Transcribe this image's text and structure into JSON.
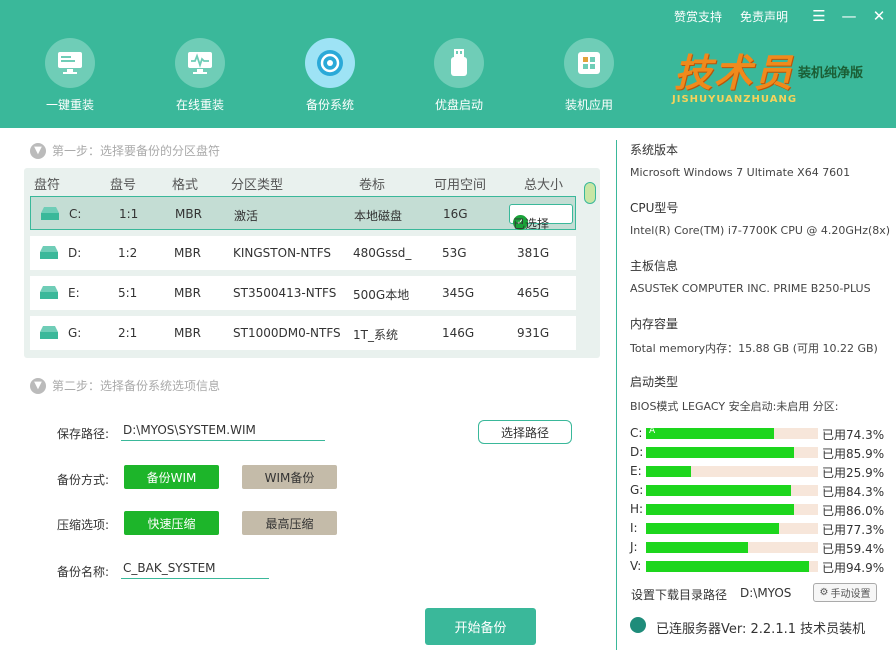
{
  "top_links": {
    "donate": "赞赏支持",
    "disclaimer": "免责声明"
  },
  "nav": [
    {
      "label": "一键重装"
    },
    {
      "label": "在线重装"
    },
    {
      "label": "备份系统"
    },
    {
      "label": "优盘启动"
    },
    {
      "label": "装机应用"
    }
  ],
  "logo": {
    "main": "技术员",
    "sub": "装机纯净版",
    "pinyin": "JISHUYUANZHUANG"
  },
  "step1": {
    "title": "第一步：选择要备份的分区盘符"
  },
  "disk_table": {
    "columns": [
      "盘符",
      "盘号",
      "格式",
      "分区类型",
      "卷标",
      "可用空间",
      "总大小"
    ],
    "rows": [
      {
        "letter": "C:",
        "num": "1:1",
        "fmt": "MBR",
        "type": "激活",
        "label": "本地磁盘",
        "free": "16G",
        "total": "",
        "status": "已选择"
      },
      {
        "letter": "D:",
        "num": "1:2",
        "fmt": "MBR",
        "type": "KINGSTON-NTFS",
        "label": "480Gssd_",
        "free": "53G",
        "total": "381G"
      },
      {
        "letter": "E:",
        "num": "5:1",
        "fmt": "MBR",
        "type": "ST3500413-NTFS",
        "label": "500G本地",
        "free": "345G",
        "total": "465G"
      },
      {
        "letter": "G:",
        "num": "2:1",
        "fmt": "MBR",
        "type": "ST1000DM0-NTFS",
        "label": "1T_系统",
        "free": "146G",
        "total": "931G"
      }
    ]
  },
  "step2": {
    "title": "第二步：选择备份系统选项信息"
  },
  "form": {
    "save_path_label": "保存路径:",
    "save_path_value": "D:\\MYOS\\SYSTEM.WIM",
    "choose_path": "选择路径",
    "backup_mode_label": "备份方式:",
    "mode_a": "备份WIM",
    "mode_b": "WIM备份",
    "compress_label": "压缩选项:",
    "compress_a": "快速压缩",
    "compress_b": "最高压缩",
    "name_label": "备份名称:",
    "name_value": "C_BAK_SYSTEM",
    "start": "开始备份"
  },
  "sysinfo": {
    "os_title": "系统版本",
    "os_value": "Microsoft Windows 7 Ultimate X64  7601",
    "cpu_title": "CPU型号",
    "cpu_value": "Intel(R) Core(TM) i7-7700K CPU @ 4.20GHz(8x)",
    "board_title": "主板信息",
    "board_value": "ASUSTeK COMPUTER INC. PRIME B250-PLUS",
    "mem_title": "内存容量",
    "mem_value": "Total memory内存：15.88 GB (可用 10.22 GB)",
    "boot_title": "启动类型",
    "boot_value": "BIOS模式 LEGACY 安全启动:未启用 分区:"
  },
  "usage": [
    {
      "letter": "C:",
      "pct": 74.3,
      "text": "已用74.3%",
      "mark": "A"
    },
    {
      "letter": "D:",
      "pct": 85.9,
      "text": "已用85.9%"
    },
    {
      "letter": "E:",
      "pct": 25.9,
      "text": "已用25.9%"
    },
    {
      "letter": "G:",
      "pct": 84.3,
      "text": "已用84.3%"
    },
    {
      "letter": "H:",
      "pct": 86.0,
      "text": "已用86.0%"
    },
    {
      "letter": "I:",
      "pct": 77.3,
      "text": "已用77.3%"
    },
    {
      "letter": "J:",
      "pct": 59.4,
      "text": "已用59.4%"
    },
    {
      "letter": "V:",
      "pct": 94.9,
      "text": "已用94.9%"
    }
  ],
  "download": {
    "label": "设置下载目录路径",
    "path": "D:\\MYOS",
    "manual": "手动设置"
  },
  "server": {
    "status": "已连服务器Ver: 2.2.1.1  技术员装机"
  },
  "colors": {
    "header": "#3ab89a",
    "accent": "#1db52a",
    "bar_fill": "#1dd61d"
  }
}
